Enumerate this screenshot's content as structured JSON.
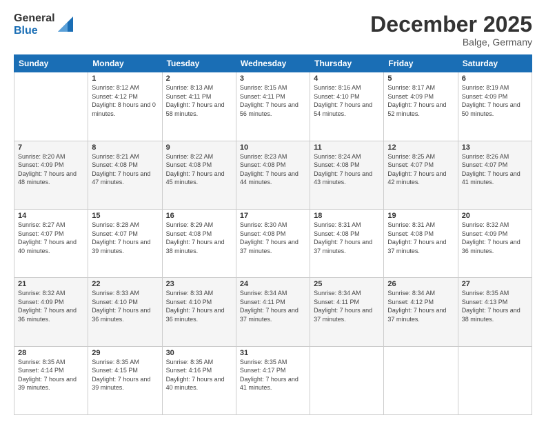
{
  "header": {
    "logo": {
      "general": "General",
      "blue": "Blue"
    },
    "title": "December 2025",
    "location": "Balge, Germany"
  },
  "days_of_week": [
    "Sunday",
    "Monday",
    "Tuesday",
    "Wednesday",
    "Thursday",
    "Friday",
    "Saturday"
  ],
  "weeks": [
    [
      {
        "day": "",
        "sunrise": "",
        "sunset": "",
        "daylight": ""
      },
      {
        "day": "1",
        "sunrise": "Sunrise: 8:12 AM",
        "sunset": "Sunset: 4:12 PM",
        "daylight": "Daylight: 8 hours and 0 minutes."
      },
      {
        "day": "2",
        "sunrise": "Sunrise: 8:13 AM",
        "sunset": "Sunset: 4:11 PM",
        "daylight": "Daylight: 7 hours and 58 minutes."
      },
      {
        "day": "3",
        "sunrise": "Sunrise: 8:15 AM",
        "sunset": "Sunset: 4:11 PM",
        "daylight": "Daylight: 7 hours and 56 minutes."
      },
      {
        "day": "4",
        "sunrise": "Sunrise: 8:16 AM",
        "sunset": "Sunset: 4:10 PM",
        "daylight": "Daylight: 7 hours and 54 minutes."
      },
      {
        "day": "5",
        "sunrise": "Sunrise: 8:17 AM",
        "sunset": "Sunset: 4:09 PM",
        "daylight": "Daylight: 7 hours and 52 minutes."
      },
      {
        "day": "6",
        "sunrise": "Sunrise: 8:19 AM",
        "sunset": "Sunset: 4:09 PM",
        "daylight": "Daylight: 7 hours and 50 minutes."
      }
    ],
    [
      {
        "day": "7",
        "sunrise": "Sunrise: 8:20 AM",
        "sunset": "Sunset: 4:09 PM",
        "daylight": "Daylight: 7 hours and 48 minutes."
      },
      {
        "day": "8",
        "sunrise": "Sunrise: 8:21 AM",
        "sunset": "Sunset: 4:08 PM",
        "daylight": "Daylight: 7 hours and 47 minutes."
      },
      {
        "day": "9",
        "sunrise": "Sunrise: 8:22 AM",
        "sunset": "Sunset: 4:08 PM",
        "daylight": "Daylight: 7 hours and 45 minutes."
      },
      {
        "day": "10",
        "sunrise": "Sunrise: 8:23 AM",
        "sunset": "Sunset: 4:08 PM",
        "daylight": "Daylight: 7 hours and 44 minutes."
      },
      {
        "day": "11",
        "sunrise": "Sunrise: 8:24 AM",
        "sunset": "Sunset: 4:08 PM",
        "daylight": "Daylight: 7 hours and 43 minutes."
      },
      {
        "day": "12",
        "sunrise": "Sunrise: 8:25 AM",
        "sunset": "Sunset: 4:07 PM",
        "daylight": "Daylight: 7 hours and 42 minutes."
      },
      {
        "day": "13",
        "sunrise": "Sunrise: 8:26 AM",
        "sunset": "Sunset: 4:07 PM",
        "daylight": "Daylight: 7 hours and 41 minutes."
      }
    ],
    [
      {
        "day": "14",
        "sunrise": "Sunrise: 8:27 AM",
        "sunset": "Sunset: 4:07 PM",
        "daylight": "Daylight: 7 hours and 40 minutes."
      },
      {
        "day": "15",
        "sunrise": "Sunrise: 8:28 AM",
        "sunset": "Sunset: 4:07 PM",
        "daylight": "Daylight: 7 hours and 39 minutes."
      },
      {
        "day": "16",
        "sunrise": "Sunrise: 8:29 AM",
        "sunset": "Sunset: 4:08 PM",
        "daylight": "Daylight: 7 hours and 38 minutes."
      },
      {
        "day": "17",
        "sunrise": "Sunrise: 8:30 AM",
        "sunset": "Sunset: 4:08 PM",
        "daylight": "Daylight: 7 hours and 37 minutes."
      },
      {
        "day": "18",
        "sunrise": "Sunrise: 8:31 AM",
        "sunset": "Sunset: 4:08 PM",
        "daylight": "Daylight: 7 hours and 37 minutes."
      },
      {
        "day": "19",
        "sunrise": "Sunrise: 8:31 AM",
        "sunset": "Sunset: 4:08 PM",
        "daylight": "Daylight: 7 hours and 37 minutes."
      },
      {
        "day": "20",
        "sunrise": "Sunrise: 8:32 AM",
        "sunset": "Sunset: 4:09 PM",
        "daylight": "Daylight: 7 hours and 36 minutes."
      }
    ],
    [
      {
        "day": "21",
        "sunrise": "Sunrise: 8:32 AM",
        "sunset": "Sunset: 4:09 PM",
        "daylight": "Daylight: 7 hours and 36 minutes."
      },
      {
        "day": "22",
        "sunrise": "Sunrise: 8:33 AM",
        "sunset": "Sunset: 4:10 PM",
        "daylight": "Daylight: 7 hours and 36 minutes."
      },
      {
        "day": "23",
        "sunrise": "Sunrise: 8:33 AM",
        "sunset": "Sunset: 4:10 PM",
        "daylight": "Daylight: 7 hours and 36 minutes."
      },
      {
        "day": "24",
        "sunrise": "Sunrise: 8:34 AM",
        "sunset": "Sunset: 4:11 PM",
        "daylight": "Daylight: 7 hours and 37 minutes."
      },
      {
        "day": "25",
        "sunrise": "Sunrise: 8:34 AM",
        "sunset": "Sunset: 4:11 PM",
        "daylight": "Daylight: 7 hours and 37 minutes."
      },
      {
        "day": "26",
        "sunrise": "Sunrise: 8:34 AM",
        "sunset": "Sunset: 4:12 PM",
        "daylight": "Daylight: 7 hours and 37 minutes."
      },
      {
        "day": "27",
        "sunrise": "Sunrise: 8:35 AM",
        "sunset": "Sunset: 4:13 PM",
        "daylight": "Daylight: 7 hours and 38 minutes."
      }
    ],
    [
      {
        "day": "28",
        "sunrise": "Sunrise: 8:35 AM",
        "sunset": "Sunset: 4:14 PM",
        "daylight": "Daylight: 7 hours and 39 minutes."
      },
      {
        "day": "29",
        "sunrise": "Sunrise: 8:35 AM",
        "sunset": "Sunset: 4:15 PM",
        "daylight": "Daylight: 7 hours and 39 minutes."
      },
      {
        "day": "30",
        "sunrise": "Sunrise: 8:35 AM",
        "sunset": "Sunset: 4:16 PM",
        "daylight": "Daylight: 7 hours and 40 minutes."
      },
      {
        "day": "31",
        "sunrise": "Sunrise: 8:35 AM",
        "sunset": "Sunset: 4:17 PM",
        "daylight": "Daylight: 7 hours and 41 minutes."
      },
      {
        "day": "",
        "sunrise": "",
        "sunset": "",
        "daylight": ""
      },
      {
        "day": "",
        "sunrise": "",
        "sunset": "",
        "daylight": ""
      },
      {
        "day": "",
        "sunrise": "",
        "sunset": "",
        "daylight": ""
      }
    ]
  ]
}
